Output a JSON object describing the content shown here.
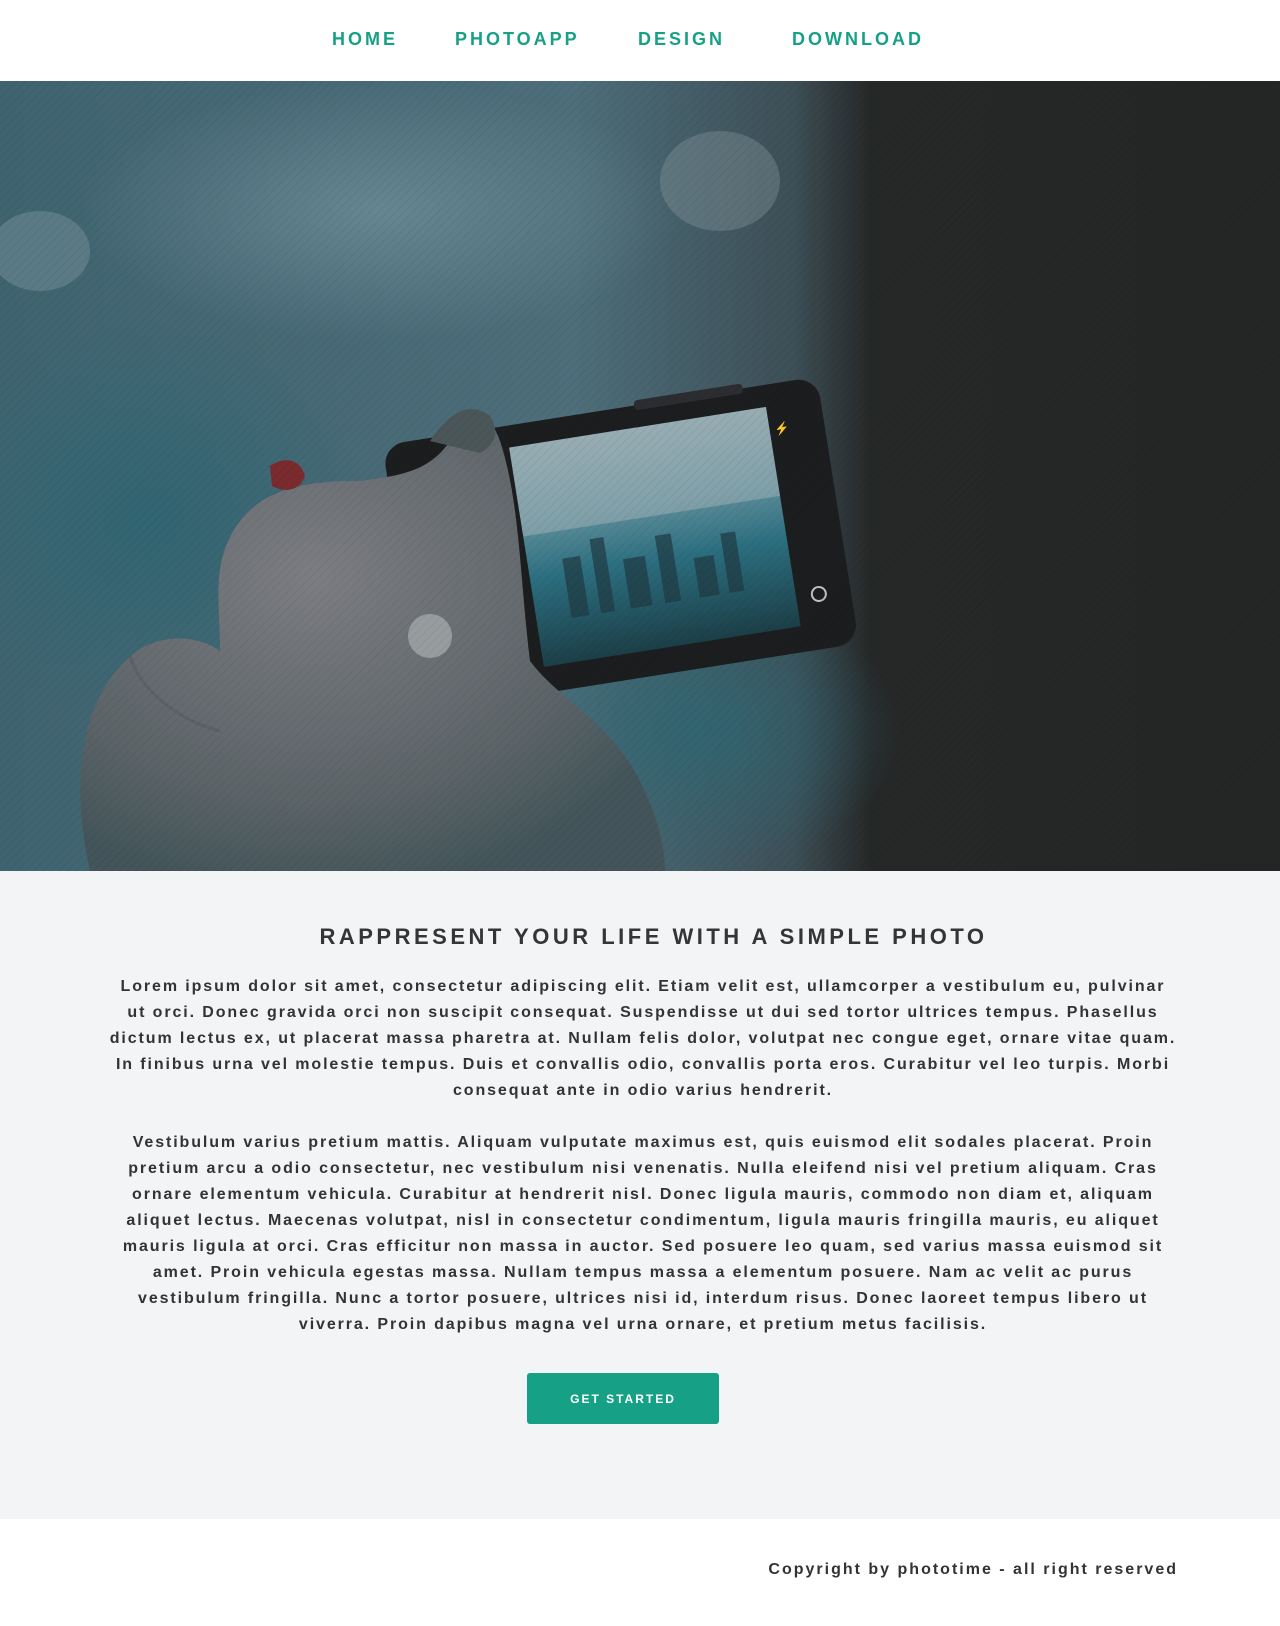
{
  "nav": {
    "items": [
      {
        "label": "HOME"
      },
      {
        "label": "PHOTOAPP"
      },
      {
        "label": "DESIGN"
      },
      {
        "label": "DOWNLOAD"
      }
    ]
  },
  "hero": {
    "image": "hand-holding-phone-photo"
  },
  "content": {
    "headline": "RAPPRESENT YOUR LIFE WITH A SIMPLE PHOTO",
    "paragraphs": [
      "Lorem ipsum dolor sit amet, consectetur adipiscing elit. Etiam velit est, ullamcorper a vestibulum eu, pulvinar ut orci. Donec gravida orci non suscipit consequat. Suspendisse ut dui sed tortor ultrices tempus. Phasellus dictum lectus ex, ut placerat massa pharetra at. Nullam felis dolor, volutpat nec congue eget, ornare vitae quam. In finibus urna vel molestie tempus. Duis et convallis odio, convallis porta eros. Curabitur vel leo turpis. Morbi consequat ante in odio varius hendrerit.",
      "Vestibulum varius pretium mattis. Aliquam vulputate maximus est, quis euismod elit sodales placerat. Proin pretium arcu a odio consectetur, nec vestibulum nisi venenatis. Nulla eleifend nisi vel pretium aliquam. Cras ornare elementum vehicula. Curabitur at hendrerit nisl. Donec ligula mauris, commodo non diam et, aliquam aliquet lectus. Maecenas volutpat, nisl in consectetur condimentum, ligula mauris fringilla mauris, eu aliquet mauris ligula at orci. Cras efficitur non massa in auctor. Sed posuere leo quam, sed varius massa euismod sit amet. Proin vehicula egestas massa. Nullam tempus massa a elementum posuere. Nam ac velit ac purus vestibulum fringilla. Nunc a tortor posuere, ultrices nisi id, interdum risus. Donec laoreet tempus libero ut viverra. Proin dapibus magna vel urna ornare, et pretium metus facilisis."
    ],
    "cta_label": "GET STARTED"
  },
  "footer": {
    "copyright": "Copyright by phototime - all right reserved"
  },
  "colors": {
    "accent": "#16a085",
    "content_bg": "#f3f4f6",
    "hero_dark": "#252727",
    "text": "#333333"
  }
}
